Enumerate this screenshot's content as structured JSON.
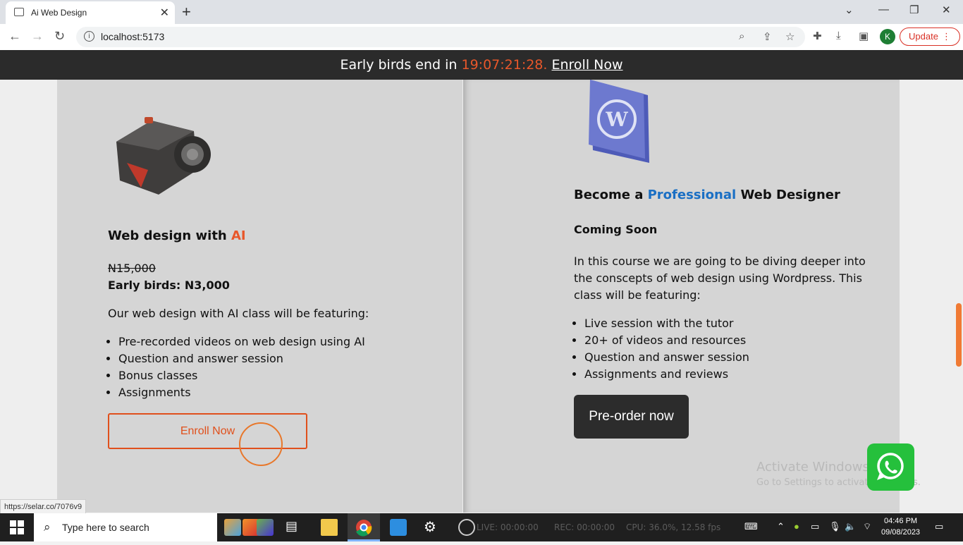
{
  "browser": {
    "tab_title": "Ai Web Design",
    "url": "localhost:5173",
    "update_label": "Update",
    "avatar_letter": "K"
  },
  "banner": {
    "prefix": "Early birds end in ",
    "timer": "19:07:21:28.",
    "link": "Enroll Now"
  },
  "course1": {
    "title_pre": "Web design with ",
    "title_accent": "AI",
    "old_price": "N15,000",
    "early_price": "Early birds: N3,000",
    "intro": "Our web design with AI class will be featuring:",
    "features": [
      "Pre-recorded videos on web design using AI",
      "Question and answer session",
      "Bonus classes",
      "Assignments"
    ],
    "button": "Enroll Now"
  },
  "course2": {
    "title_pre": "Become a ",
    "title_accent": "Professional",
    "title_post": " Web Designer",
    "status": "Coming Soon",
    "intro": "In this course we are going to be diving deeper into the conscepts of web design using Wordpress. This class will be featuring:",
    "features": [
      "Live session with the tutor",
      "20+ of videos and resources",
      "Question and answer session",
      "Assignments and reviews"
    ],
    "button": "Pre-order now"
  },
  "watermark": {
    "line1": "Activate Windows",
    "line2": "Go to Settings to activate Windows."
  },
  "status_url": "https://selar.co/7076v9",
  "taskbar": {
    "search_placeholder": "Type here to search",
    "live": "LIVE: 00:00:00",
    "rec": "REC: 00:00:00",
    "cpu": "CPU: 36.0%, 12.58 fps",
    "time": "04:46 PM",
    "date": "09/08/2023"
  },
  "colors": {
    "accent_orange": "#e8572a",
    "accent_blue": "#1a6fc4",
    "banner_bg": "#2b2b2b"
  }
}
